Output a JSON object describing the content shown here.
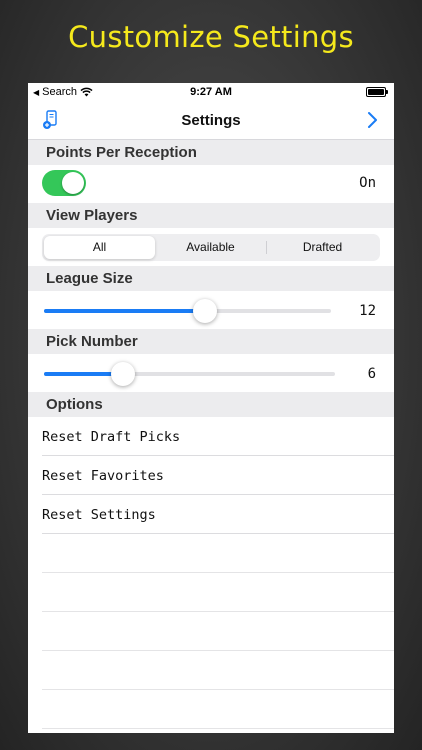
{
  "headline": "Customize Settings",
  "status_bar": {
    "back_app": "Search",
    "time": "9:27 AM"
  },
  "nav": {
    "title": "Settings",
    "left_icon": "device-icon",
    "right_icon": "chevron-right-icon"
  },
  "colors": {
    "headline": "#f5e91c",
    "toggle_on": "#34c759",
    "slider_fill": "#1a7cf5",
    "accent": "#1a7cf5"
  },
  "sections": {
    "points_per_reception": {
      "title": "Points Per Reception",
      "toggle_label": "On",
      "toggle_on": true
    },
    "view_players": {
      "title": "View Players",
      "segments": [
        "All",
        "Available",
        "Drafted"
      ],
      "selected": "All"
    },
    "league_size": {
      "title": "League Size",
      "value": "12",
      "slider_fraction": 0.56
    },
    "pick_number": {
      "title": "Pick Number",
      "value": "6",
      "slider_fraction": 0.27
    },
    "options": {
      "title": "Options",
      "items": [
        "Reset Draft Picks",
        "Reset Favorites",
        "Reset Settings"
      ]
    }
  }
}
